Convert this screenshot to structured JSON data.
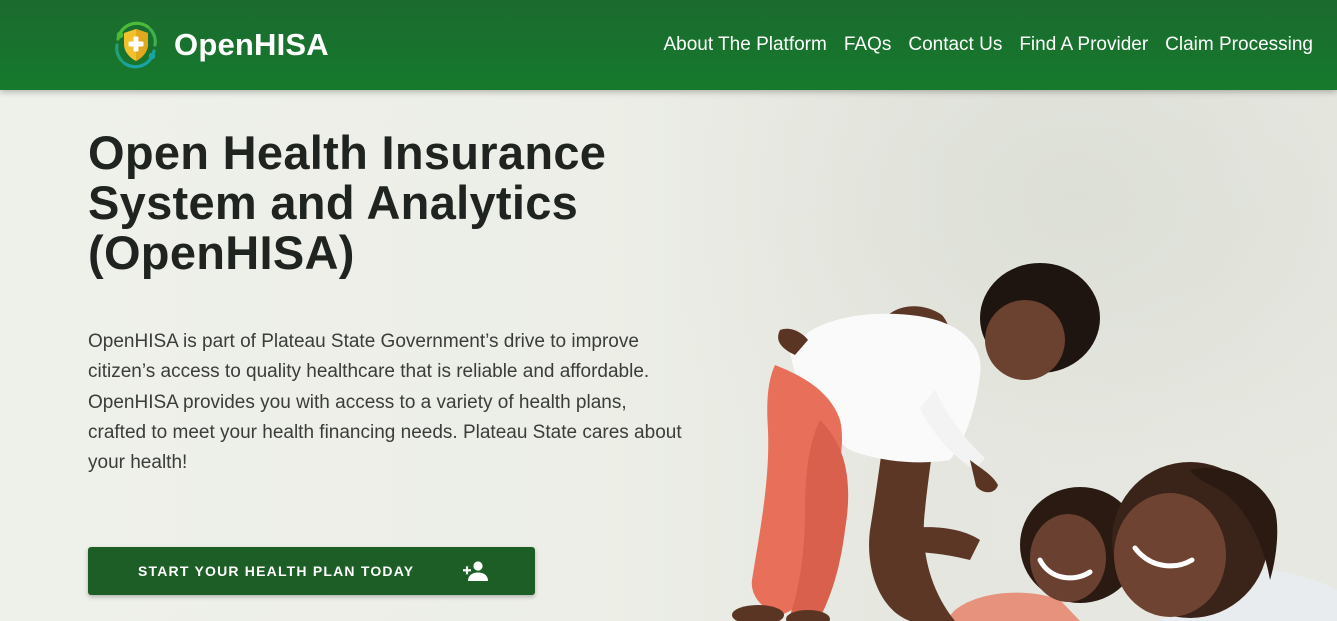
{
  "brand": {
    "name": "OpenHISA",
    "logo_icon": "shield-plus-icon",
    "colors": {
      "primary": "#1c6a2f",
      "accent_gold": "#f2c12e",
      "accent_teal": "#1aa3a0",
      "accent_green": "#4dbb3a"
    }
  },
  "nav": {
    "items": [
      {
        "label": "About The Platform"
      },
      {
        "label": "FAQs"
      },
      {
        "label": "Contact Us"
      },
      {
        "label": "Find A Provider"
      },
      {
        "label": "Claim Processing"
      }
    ]
  },
  "hero": {
    "title": "Open Health Insurance System and Analytics (OpenHISA)",
    "description": "OpenHISA is part of Plateau State Government’s drive to improve citizen’s access to quality healthcare that is reliable and affordable. OpenHISA provides you with access to a variety of health plans, crafted to meet your health financing needs. Plateau State cares about your health!",
    "cta": {
      "label": "START YOUR HEALTH PLAN TODAY",
      "icon": "person-add-icon"
    },
    "image": "family-photo"
  }
}
